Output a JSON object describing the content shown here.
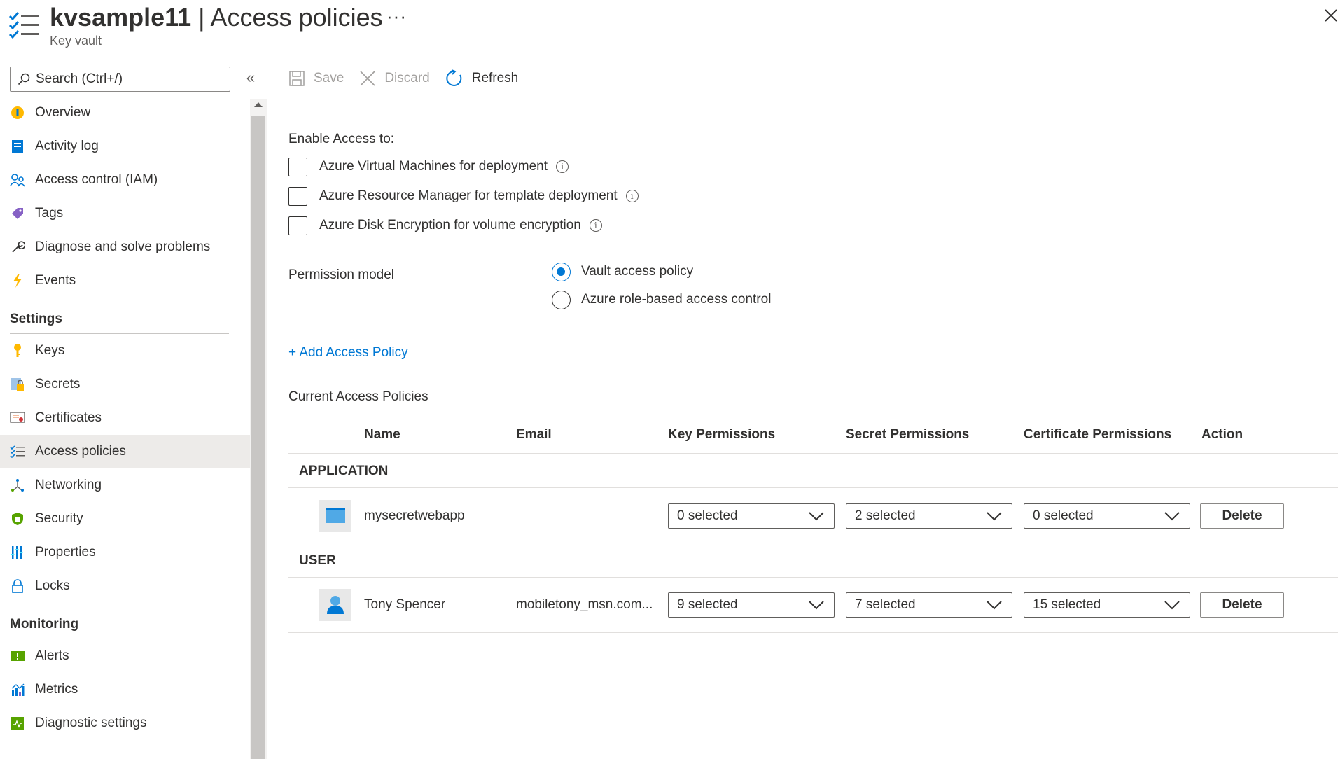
{
  "header": {
    "title_bold": "kvsample11",
    "title_rest": " | Access policies",
    "subtitle": "Key vault",
    "more": "···",
    "icon": "access-policies-icon"
  },
  "sidebar": {
    "search_placeholder": "Search (Ctrl+/)",
    "collapse": "«",
    "items_top": [
      {
        "label": "Overview",
        "icon": "overview-icon"
      },
      {
        "label": "Activity log",
        "icon": "activity-log-icon"
      },
      {
        "label": "Access control (IAM)",
        "icon": "iam-icon"
      },
      {
        "label": "Tags",
        "icon": "tag-icon"
      },
      {
        "label": "Diagnose and solve problems",
        "icon": "wrench-icon"
      },
      {
        "label": "Events",
        "icon": "lightning-icon"
      }
    ],
    "section_settings": "Settings",
    "items_settings": [
      {
        "label": "Keys",
        "icon": "key-icon"
      },
      {
        "label": "Secrets",
        "icon": "secret-icon"
      },
      {
        "label": "Certificates",
        "icon": "certificate-icon"
      },
      {
        "label": "Access policies",
        "icon": "access-policies-icon",
        "active": true
      },
      {
        "label": "Networking",
        "icon": "networking-icon"
      },
      {
        "label": "Security",
        "icon": "shield-icon"
      },
      {
        "label": "Properties",
        "icon": "properties-icon"
      },
      {
        "label": "Locks",
        "icon": "lock-icon"
      }
    ],
    "section_monitoring": "Monitoring",
    "items_monitoring": [
      {
        "label": "Alerts",
        "icon": "alert-icon"
      },
      {
        "label": "Metrics",
        "icon": "metrics-icon"
      },
      {
        "label": "Diagnostic settings",
        "icon": "diagnostic-icon"
      }
    ]
  },
  "toolbar": {
    "save": "Save",
    "discard": "Discard",
    "refresh": "Refresh"
  },
  "enable_access": {
    "label": "Enable Access to:",
    "options": [
      {
        "label": "Azure Virtual Machines for deployment",
        "checked": false
      },
      {
        "label": "Azure Resource Manager for template deployment",
        "checked": false
      },
      {
        "label": "Azure Disk Encryption for volume encryption",
        "checked": false
      }
    ]
  },
  "permission_model": {
    "label": "Permission model",
    "options": [
      {
        "label": "Vault access policy",
        "selected": true
      },
      {
        "label": "Azure role-based access control",
        "selected": false
      }
    ]
  },
  "add_policy": "+ Add Access Policy",
  "current_policies": {
    "label": "Current Access Policies",
    "columns": [
      "Name",
      "Email",
      "Key Permissions",
      "Secret Permissions",
      "Certificate Permissions",
      "Action"
    ],
    "groups": [
      {
        "name": "APPLICATION",
        "rows": [
          {
            "name": "mysecretwebapp",
            "email": "",
            "key": "0 selected",
            "secret": "2 selected",
            "certificate": "0 selected",
            "action": "Delete",
            "icon": "app-icon"
          }
        ]
      },
      {
        "name": "USER",
        "rows": [
          {
            "name": "Tony Spencer",
            "email": "mobiletony_msn.com...",
            "key": "9 selected",
            "secret": "7 selected",
            "certificate": "15 selected",
            "action": "Delete",
            "icon": "user-icon"
          }
        ]
      }
    ]
  },
  "colors": {
    "accent": "#0078d4",
    "text": "#323130",
    "disabled": "#a19f9d"
  }
}
